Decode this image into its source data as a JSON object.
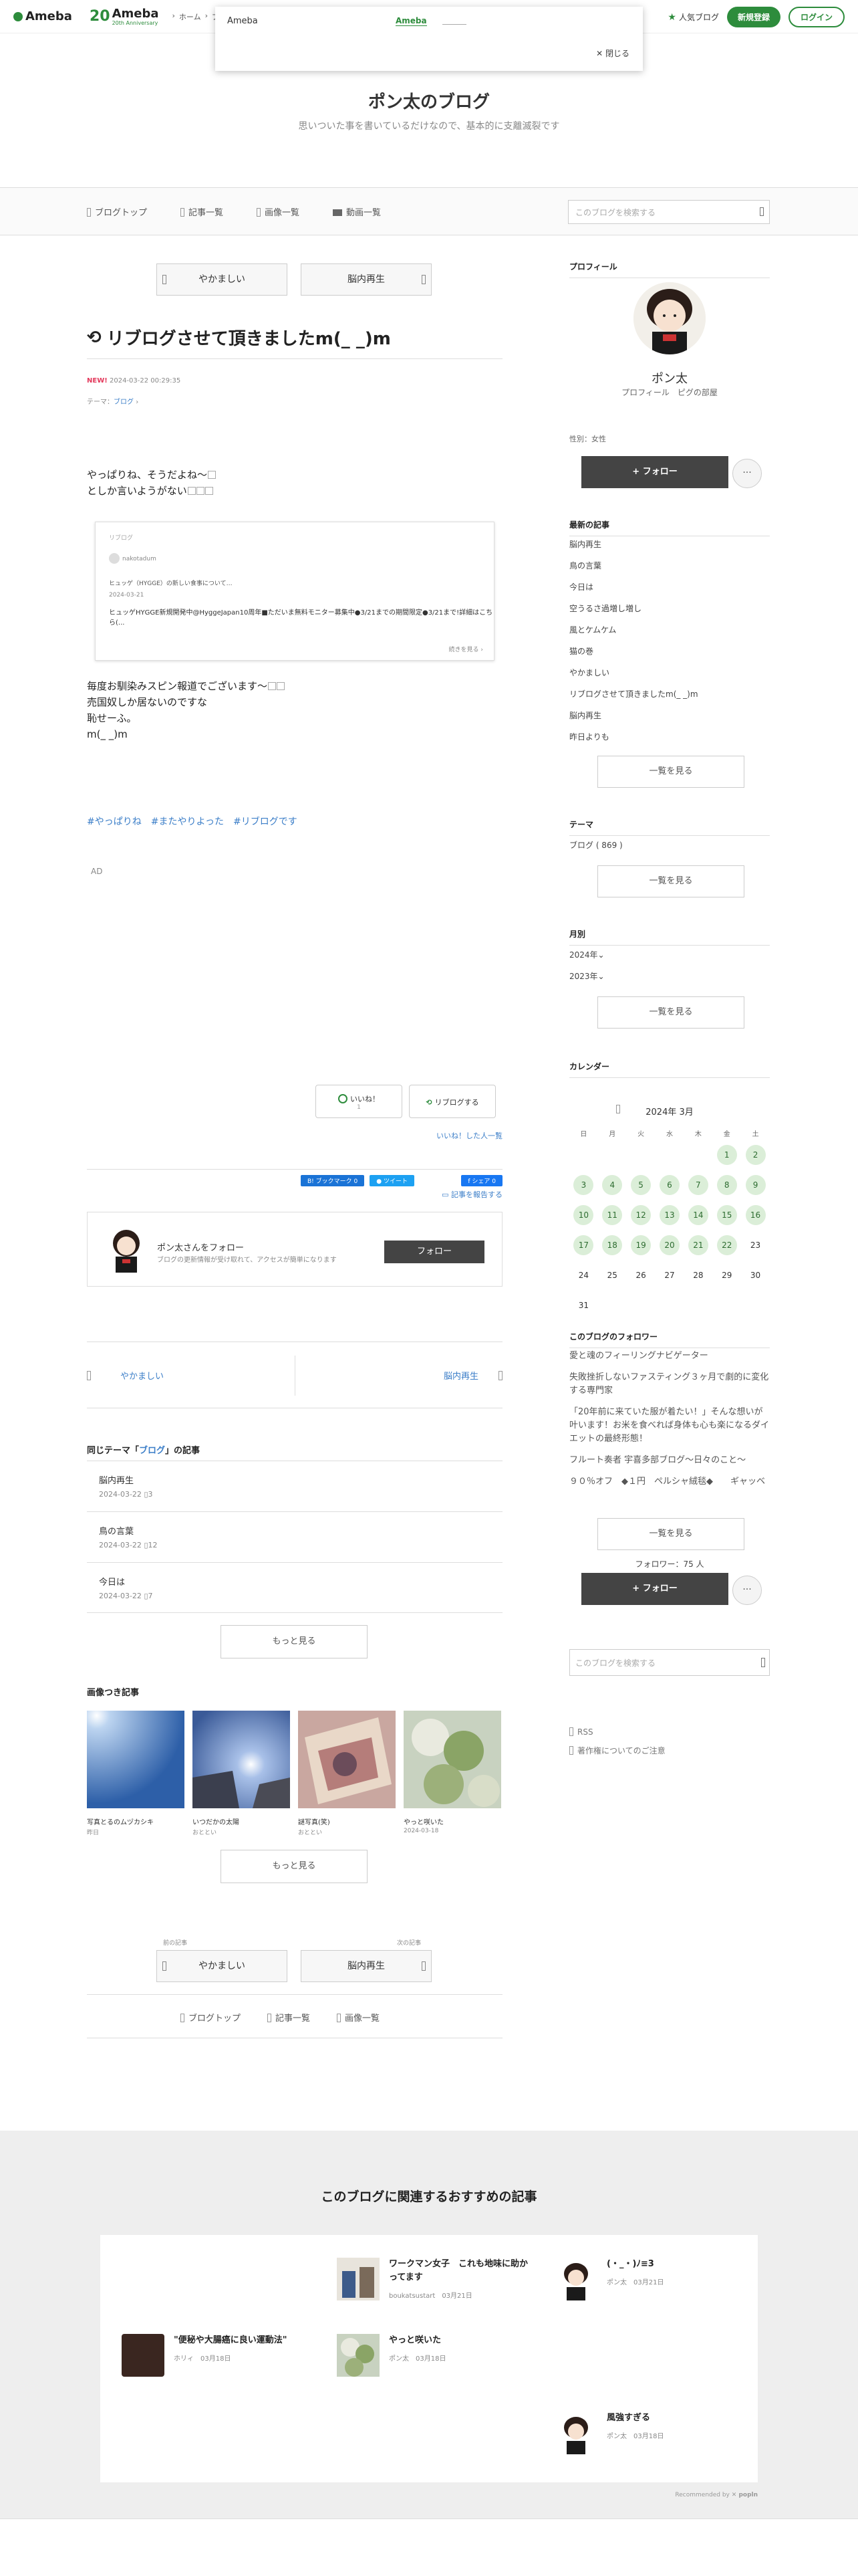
{
  "topbar": {
    "logo": "Ameba",
    "anniv_num": "20",
    "anniv_logo": "Ameba",
    "anniv_sub": "20th Anniversary",
    "crumbs": [
      "ホーム",
      "ブ"
    ],
    "popular": "人気ブログ",
    "signup": "新規登録",
    "login": "ログイン"
  },
  "popup": {
    "title": "Ameba",
    "link": "Ameba",
    "close": "✕ 閉じる"
  },
  "header": {
    "blog_title": "ポン太のブログ",
    "subtitle": "思いついた事を書いているだけなので、基本的に支離滅裂です"
  },
  "nav": {
    "items": [
      "ブログトップ",
      "記事一覧",
      "画像一覧",
      "動画一覧"
    ],
    "search_placeholder": "このブログを検索する"
  },
  "pager_top": {
    "prev": "やかましい",
    "next": "脳内再生"
  },
  "entry": {
    "title": "リブログさせて頂きましたm(_ _)m",
    "new_label": "NEW!",
    "date": "2024-03-22 00:29:35",
    "theme_label": "テーマ：",
    "theme": "ブログ",
    "lines1": [
      "やっぱりね、そうだよね〜",
      "としか言いようがない"
    ],
    "embed": {
      "head": "リブログ",
      "author": "nakotadum",
      "headline": "ヒュッゲ（HYGGE）の新しい食事について…",
      "date": "2024-03-21",
      "text": "ヒュッゲHYGGE新規開発中@HyggeJapan10周年■ただいま無料モニター募集中●3/21までの期間限定●3/21まで!詳細はこちら(...",
      "more": "続きを見る"
    },
    "lines2": [
      "毎度お馴染みスピン報道でございます〜",
      "売国奴しか居ないのですな",
      "恥せーふ。",
      "m(_ _)m"
    ],
    "hashtags": [
      "#やっぱりね",
      "#またやりよった",
      "#リブログです"
    ],
    "ad": "AD"
  },
  "actions": {
    "like": "いいね！",
    "like_count": "1",
    "reblog": "リブログする",
    "liked_list": "いいね！した人一覧",
    "hatena": "B! ブックマーク 0",
    "tweet": "ツイート",
    "fb": "シェア 0",
    "report": "記事を報告する"
  },
  "followbox": {
    "name": "ポン太さんをフォロー",
    "sub": "ブログの更新情報が受け取れて、アクセスが簡単になります",
    "button": "フォロー"
  },
  "prevnext": {
    "prev": "やかましい",
    "next": "脳内再生"
  },
  "same_theme": {
    "title_pre": "同じテーマ「",
    "title_theme": "ブログ",
    "title_post": "」の記事",
    "rows": [
      {
        "title": "脳内再生",
        "date": "2024-03-22",
        "count": "3"
      },
      {
        "title": "鳥の言葉",
        "date": "2024-03-22",
        "count": "12"
      },
      {
        "title": "今日は",
        "date": "2024-03-22",
        "count": "7"
      }
    ],
    "more": "もっと見る"
  },
  "image_posts": {
    "title": "画像つき記事",
    "items": [
      {
        "title": "写真とるのムヅカシキ",
        "date": "昨日"
      },
      {
        "title": "いつだかの太陽",
        "date": "おととい"
      },
      {
        "title": "謎写真(笑)",
        "date": "おととい"
      },
      {
        "title": "やっと咲いた",
        "date": "2024-03-18"
      }
    ],
    "more": "もっと見る"
  },
  "pager_bottom": {
    "prev_label": "前の記事",
    "next_label": "次の記事",
    "prev": "やかましい",
    "next": "脳内再生"
  },
  "bottom_nav": [
    "ブログトップ",
    "記事一覧",
    "画像一覧"
  ],
  "sidebar": {
    "profile_head": "プロフィール",
    "name": "ポン太",
    "profile_link": "プロフィール",
    "room_link": "ピグの部屋",
    "sex": "性別：女性",
    "follow": "+ フォロー",
    "dots": "···",
    "recent_head": "最新の記事",
    "recent": [
      "脳内再生",
      "鳥の言葉",
      "今日は",
      "空うるさ過増し増し",
      "風とケムケム",
      "猫の巻",
      "やかましい",
      "リブログさせて頂きましたm(_ _)m",
      "脳内再生",
      "昨日よりも"
    ],
    "see_list": "一覧を見る",
    "theme_head": "テーマ",
    "themes": [
      "ブログ ( 869 )"
    ],
    "monthly_head": "月別",
    "months": [
      "2024年",
      "2023年"
    ],
    "calendar_head": "カレンダー",
    "cal_month": "2024年 3月",
    "weekdays": [
      "日",
      "月",
      "火",
      "水",
      "木",
      "金",
      "土"
    ],
    "followers_head": "このブログのフォロワー",
    "followers": [
      "愛と魂のフィーリングナビゲーター",
      "失敗挫折しないファスティング３ヶ月で劇的に変化する専門家",
      "「20年前に来ていた服が着たい！」そんな想いが叶います！お米を食べれば身体も心も楽になるダイエットの最終形態！",
      "フルート奏者 宇喜多部ブログ〜日々のこと〜",
      "９０％オフ　◆１円　ペルシャ絨毯◆　　ギャッベ"
    ],
    "follower_count": "フォロワー：75 人",
    "search_placeholder": "このブログを検索する",
    "rss": "RSS",
    "copyright": "著作権についてのご注意"
  },
  "recommend": {
    "title": "このブログに関連するおすすめの記事",
    "items": [
      {
        "title": "ワークマン女子　これも地味に助かってます",
        "author": "boukatsustart",
        "date": "03月21日"
      },
      {
        "title": "(・_・)ﾉ≡3",
        "author": "ポン太",
        "date": "03月21日"
      },
      {
        "title": "\"便秘や大腸癌に良い運動法\"",
        "author": "ホリィ",
        "date": "03月18日"
      },
      {
        "title": "やっと咲いた",
        "author": "ポン太",
        "date": "03月18日"
      },
      {
        "title": "風強すぎる",
        "author": "ポン太",
        "date": "03月18日"
      }
    ],
    "by": "Recommended by",
    "by_brand": "✕ popln"
  }
}
